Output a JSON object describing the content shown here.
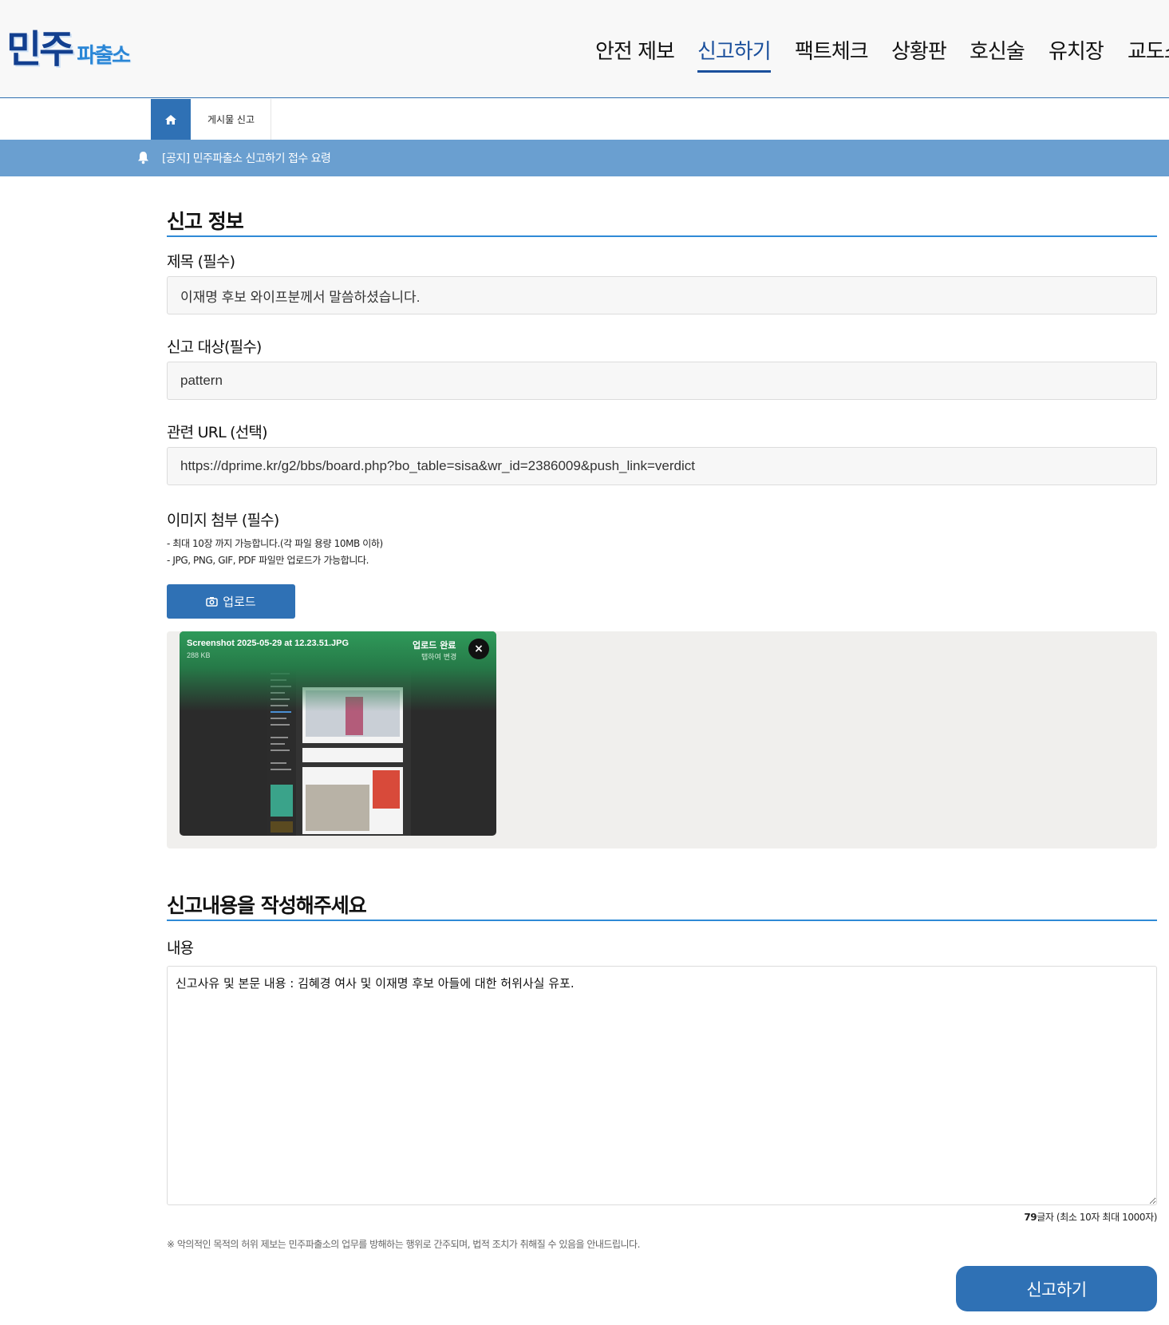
{
  "logo": {
    "main": "민주",
    "sub": "파출소"
  },
  "nav": {
    "items": [
      {
        "label": "안전 제보",
        "active": false
      },
      {
        "label": "신고하기",
        "active": true
      },
      {
        "label": "팩트체크",
        "active": false
      },
      {
        "label": "상황판",
        "active": false
      },
      {
        "label": "호신술",
        "active": false
      },
      {
        "label": "유치장",
        "active": false
      },
      {
        "label": "교도소",
        "active": false
      }
    ]
  },
  "breadcrumb": {
    "current": "게시물 신고"
  },
  "notice": {
    "text": "[공지] 민주파출소 신고하기 접수 요령"
  },
  "report_info": {
    "heading": "신고 정보",
    "title_label": "제목 (필수)",
    "title_value": "이재명 후보 와이프분께서 말씀하셨습니다.",
    "target_label": "신고 대상(필수)",
    "target_value": "pattern",
    "url_label": "관련 URL (선택)",
    "url_value": "https://dprime.kr/g2/bbs/board.php?bo_table=sisa&wr_id=2386009&push_link=verdict",
    "image_label": "이미지 첨부 (필수)",
    "image_help_1": "- 최대 10장 까지 가능합니다.(각 파일 용량 10MB 이하)",
    "image_help_2": "- JPG, PNG, GIF, PDF 파일만 업로드가 가능합니다.",
    "upload_button": "업로드"
  },
  "attachment": {
    "file_name": "Screenshot 2025-05-29 at 12.23.51.JPG",
    "file_size": "288 KB",
    "status": "업로드 완료",
    "change_hint": "탭하여 변경",
    "close_symbol": "×"
  },
  "content_section": {
    "heading": "신고내용을 작성해주세요",
    "content_label": "내용",
    "content_value": "신고사유 및 본문 내용 : 김혜경 여사 및 이재명 후보 아들에 대한 허위사실 유포.",
    "char_count": "79",
    "char_count_suffix": "글자 (최소 10자 최대 1000자)",
    "warning": "※ 악의적인 목적의 허위 제보는 민주파출소의 업무를 방해하는 행위로 간주되며, 법적 조치가 취해질 수 있음을 안내드립니다.",
    "submit_button": "신고하기"
  },
  "colors": {
    "brand_blue": "#2f71b5",
    "nav_active": "#1a4f9c",
    "notice_bar": "#6a9fd0",
    "section_line": "#2f8ad6",
    "upload_green": "#2f9a5a"
  }
}
